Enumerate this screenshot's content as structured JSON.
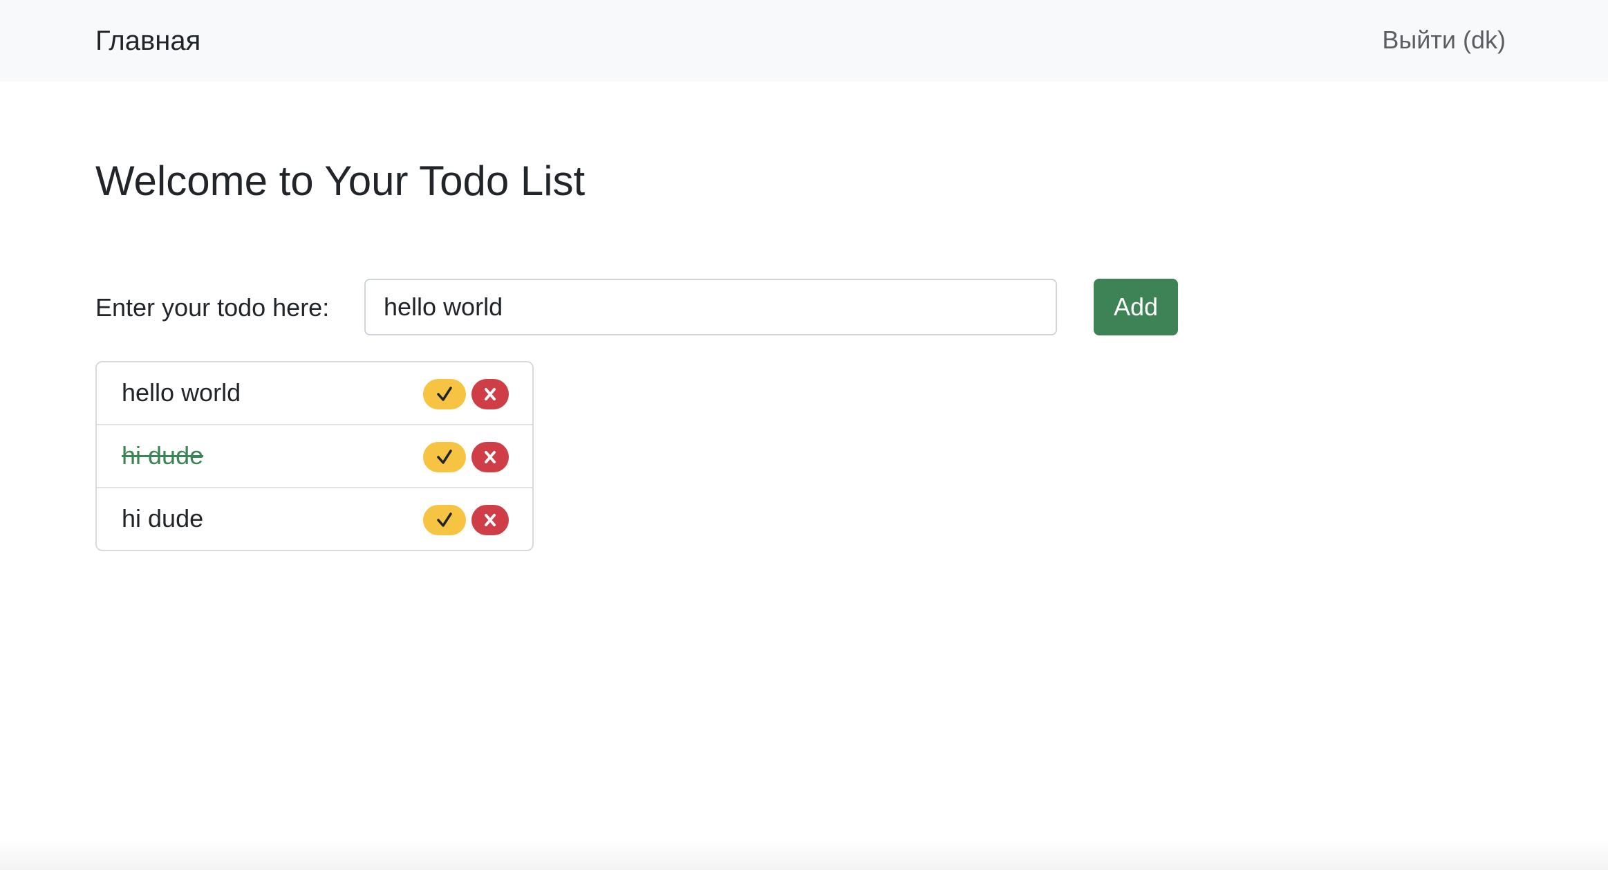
{
  "navbar": {
    "brand": "Главная",
    "logout": "Выйти (dk)"
  },
  "main": {
    "title": "Welcome to Your Todo List",
    "form": {
      "label": "Enter your todo here:",
      "input_value": "hello world",
      "add_label": "Add"
    },
    "todos": [
      {
        "text": "hello world",
        "completed": false
      },
      {
        "text": "hi dude",
        "completed": true
      },
      {
        "text": "hi dude",
        "completed": false
      }
    ],
    "complete_icon": "checkmark-icon",
    "delete_icon": "x-icon"
  },
  "colors": {
    "success": "#3d8356",
    "warning": "#f6c343",
    "danger": "#cf3e46",
    "navbar_bg": "#f8f9fa"
  }
}
